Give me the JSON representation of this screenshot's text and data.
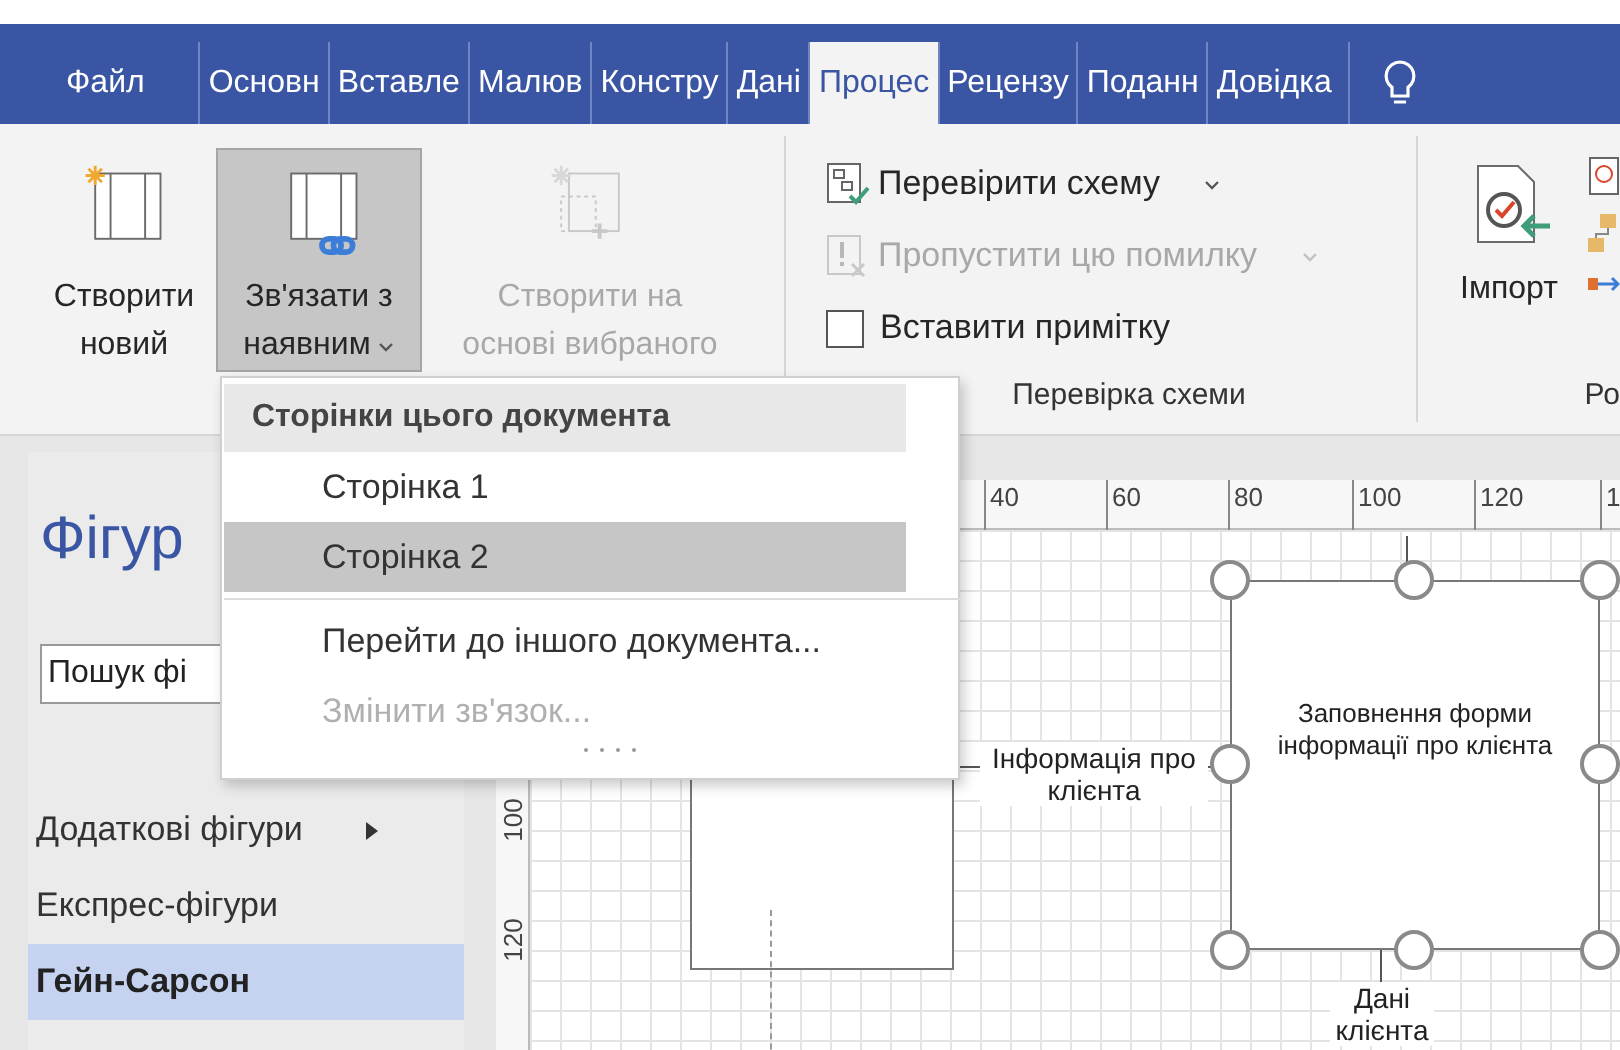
{
  "tabs": [
    {
      "label": "Файл",
      "selected": false
    },
    {
      "label": "Основн",
      "selected": false
    },
    {
      "label": "Вставле",
      "selected": false
    },
    {
      "label": "Малюв",
      "selected": false
    },
    {
      "label": "Констру",
      "selected": false
    },
    {
      "label": "Дані",
      "selected": false
    },
    {
      "label": "Процес",
      "selected": true
    },
    {
      "label": "Рецензу",
      "selected": false
    },
    {
      "label": "Поданн",
      "selected": false
    },
    {
      "label": "Довідка",
      "selected": false
    }
  ],
  "ribbon": {
    "groups": [
      {
        "controls": [
          {
            "kind": "large",
            "lines": [
              "Створити",
              "новий"
            ],
            "selected": false,
            "disabled": false,
            "dropdown": false
          },
          {
            "kind": "large",
            "lines": [
              "Зв'язати з",
              "наявним"
            ],
            "selected": true,
            "disabled": false,
            "dropdown": true
          },
          {
            "kind": "large",
            "lines": [
              "Створити на",
              "основі вибраного"
            ],
            "selected": false,
            "disabled": true,
            "dropdown": false
          }
        ]
      },
      {
        "label": "Перевірка схеми",
        "controls": [
          {
            "kind": "small",
            "label": "Перевірити схему",
            "disabled": false,
            "dropdown": true
          },
          {
            "kind": "small",
            "label": "Пропустити цю помилку",
            "disabled": true,
            "dropdown": true
          },
          {
            "kind": "checkbox",
            "label": "Вставити примітку",
            "checked": false
          }
        ]
      },
      {
        "label": "Ро",
        "controls": [
          {
            "kind": "large",
            "lines": [
              "Імпорт"
            ],
            "selected": false,
            "disabled": false,
            "dropdown": false
          }
        ]
      }
    ]
  },
  "menu": {
    "header": "Сторінки цього документа",
    "items": [
      {
        "kind": "page",
        "label": "Сторінка 1",
        "selected": false,
        "disabled": false
      },
      {
        "kind": "page",
        "label": "Сторінка 2",
        "selected": true,
        "disabled": false
      },
      {
        "kind": "action",
        "label": "Перейти до іншого документа...",
        "selected": false,
        "disabled": false
      },
      {
        "kind": "action",
        "label": "Змінити зв'язок...",
        "selected": false,
        "disabled": true
      }
    ]
  },
  "shapes_pane": {
    "title": "Фігур",
    "search": {
      "placeholder": "Пошук фі"
    },
    "items": [
      {
        "label": "Додаткові фігури",
        "selected": false,
        "submenu": true
      },
      {
        "label": "Експрес-фігури",
        "selected": false,
        "submenu": false
      },
      {
        "label": "Гейн-Сарсон",
        "selected": true,
        "submenu": false
      }
    ]
  },
  "rulers": {
    "horizontal": [
      "40",
      "60",
      "80",
      "100",
      "120",
      "1"
    ],
    "vertical": [
      "100",
      "120"
    ]
  },
  "diagram": {
    "process": {
      "text": "Заповнення форми інформації про клієнта"
    },
    "flows": [
      {
        "label": "Інформація про клієнта"
      },
      {
        "label": "Дані клієнта"
      }
    ]
  }
}
